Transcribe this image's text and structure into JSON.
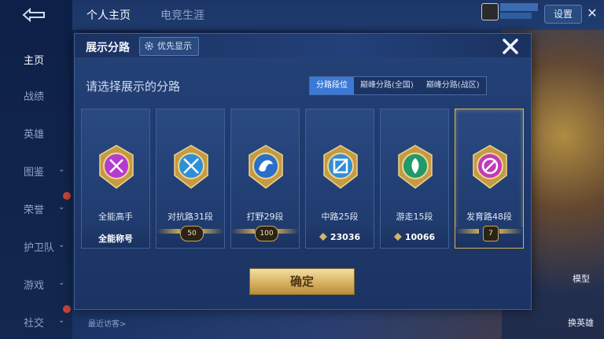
{
  "top_tabs": [
    "个人主页",
    "电竞生涯"
  ],
  "top_right": {
    "settings_label": "设置",
    "close_glyph": "✕"
  },
  "sidebar": {
    "items": [
      {
        "label": "主页",
        "active": true,
        "chevron": false
      },
      {
        "label": "战绩",
        "active": false,
        "chevron": false
      },
      {
        "label": "英雄",
        "active": false,
        "chevron": false
      },
      {
        "label": "图鉴",
        "active": false,
        "chevron": true
      },
      {
        "label": "荣誉",
        "active": false,
        "chevron": true
      },
      {
        "label": "护卫队",
        "active": false,
        "chevron": true
      },
      {
        "label": "游戏",
        "active": false,
        "chevron": true
      },
      {
        "label": "社交",
        "active": false,
        "chevron": true
      }
    ]
  },
  "background": {
    "visitors_label": "最近访客>",
    "right_labels": [
      "模型",
      "换英雄"
    ]
  },
  "modal": {
    "title": "展示分路",
    "priority_button": "优先显示",
    "subtitle": "请选择展示的分路",
    "tabs": [
      {
        "label": "分路段位",
        "active": true
      },
      {
        "label": "巅峰分路(全国)",
        "active": false
      },
      {
        "label": "巅峰分路(战区)",
        "active": false
      }
    ],
    "cards": [
      {
        "name": "全能高手",
        "footer_type": "text",
        "footer": "全能称号",
        "emblem_color": "#b53bd0",
        "emblem": "omni-emblem-icon",
        "selected": false
      },
      {
        "name": "对抗路31段",
        "footer_type": "badge",
        "footer": "50",
        "emblem_color": "#2f8fd6",
        "emblem": "sword-emblem-icon",
        "selected": false
      },
      {
        "name": "打野29段",
        "footer_type": "badge",
        "footer": "100",
        "emblem_color": "#2a6fc8",
        "emblem": "dragon-emblem-icon",
        "selected": false
      },
      {
        "name": "中路25段",
        "footer_type": "score",
        "footer": "23036",
        "emblem_color": "#2f8fd6",
        "emblem": "staff-emblem-icon",
        "selected": false
      },
      {
        "name": "游走15段",
        "footer_type": "score",
        "footer": "10066",
        "emblem_color": "#1f9a6a",
        "emblem": "shield-emblem-icon",
        "selected": false
      },
      {
        "name": "发育路48段",
        "footer_type": "badge",
        "footer": "7",
        "emblem_color": "#c13bb8",
        "emblem": "arrow-emblem-icon",
        "selected": true
      }
    ],
    "confirm_label": "确定"
  }
}
